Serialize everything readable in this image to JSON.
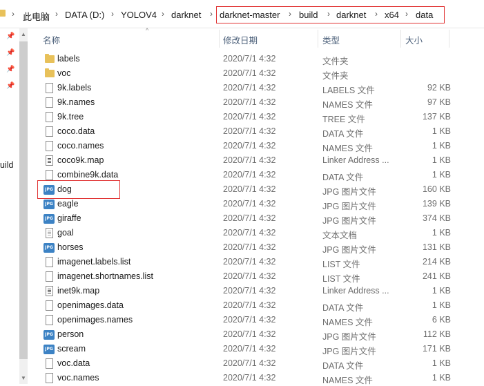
{
  "address_bar": {
    "crumbs": [
      "此电脑",
      "DATA (D:)",
      "YOLOV4",
      "darknet",
      "darknet-master",
      "build",
      "darknet",
      "x64",
      "data"
    ]
  },
  "nav_pane": {
    "partial_item": "uild"
  },
  "columns": {
    "name": "名称",
    "date": "修改日期",
    "type": "类型",
    "size": "大小"
  },
  "files": [
    {
      "name": "labels",
      "date": "2020/7/1 4:32",
      "type": "文件夹",
      "size": "",
      "icon": "folder-icon"
    },
    {
      "name": "voc",
      "date": "2020/7/1 4:32",
      "type": "文件夹",
      "size": "",
      "icon": "folder-icon"
    },
    {
      "name": "9k.labels",
      "date": "2020/7/1 4:32",
      "type": "LABELS 文件",
      "size": "92 KB",
      "icon": "file-icon"
    },
    {
      "name": "9k.names",
      "date": "2020/7/1 4:32",
      "type": "NAMES 文件",
      "size": "97 KB",
      "icon": "file-icon"
    },
    {
      "name": "9k.tree",
      "date": "2020/7/1 4:32",
      "type": "TREE 文件",
      "size": "137 KB",
      "icon": "file-icon"
    },
    {
      "name": "coco.data",
      "date": "2020/7/1 4:32",
      "type": "DATA 文件",
      "size": "1 KB",
      "icon": "file-icon"
    },
    {
      "name": "coco.names",
      "date": "2020/7/1 4:32",
      "type": "NAMES 文件",
      "size": "1 KB",
      "icon": "file-icon"
    },
    {
      "name": "coco9k.map",
      "date": "2020/7/1 4:32",
      "type": "Linker Address ...",
      "size": "1 KB",
      "icon": "map-file-icon"
    },
    {
      "name": "combine9k.data",
      "date": "2020/7/1 4:32",
      "type": "DATA 文件",
      "size": "1 KB",
      "icon": "file-icon"
    },
    {
      "name": "dog",
      "date": "2020/7/1 4:32",
      "type": "JPG 图片文件",
      "size": "160 KB",
      "icon": "jpg-icon"
    },
    {
      "name": "eagle",
      "date": "2020/7/1 4:32",
      "type": "JPG 图片文件",
      "size": "139 KB",
      "icon": "jpg-icon"
    },
    {
      "name": "giraffe",
      "date": "2020/7/1 4:32",
      "type": "JPG 图片文件",
      "size": "374 KB",
      "icon": "jpg-icon"
    },
    {
      "name": "goal",
      "date": "2020/7/1 4:32",
      "type": "文本文档",
      "size": "1 KB",
      "icon": "text-file-icon"
    },
    {
      "name": "horses",
      "date": "2020/7/1 4:32",
      "type": "JPG 图片文件",
      "size": "131 KB",
      "icon": "jpg-icon"
    },
    {
      "name": "imagenet.labels.list",
      "date": "2020/7/1 4:32",
      "type": "LIST 文件",
      "size": "214 KB",
      "icon": "file-icon"
    },
    {
      "name": "imagenet.shortnames.list",
      "date": "2020/7/1 4:32",
      "type": "LIST 文件",
      "size": "241 KB",
      "icon": "file-icon"
    },
    {
      "name": "inet9k.map",
      "date": "2020/7/1 4:32",
      "type": "Linker Address ...",
      "size": "1 KB",
      "icon": "map-file-icon"
    },
    {
      "name": "openimages.data",
      "date": "2020/7/1 4:32",
      "type": "DATA 文件",
      "size": "1 KB",
      "icon": "file-icon"
    },
    {
      "name": "openimages.names",
      "date": "2020/7/1 4:32",
      "type": "NAMES 文件",
      "size": "6 KB",
      "icon": "file-icon"
    },
    {
      "name": "person",
      "date": "2020/7/1 4:32",
      "type": "JPG 图片文件",
      "size": "112 KB",
      "icon": "jpg-icon"
    },
    {
      "name": "scream",
      "date": "2020/7/1 4:32",
      "type": "JPG 图片文件",
      "size": "171 KB",
      "icon": "jpg-icon"
    },
    {
      "name": "voc.data",
      "date": "2020/7/1 4:32",
      "type": "DATA 文件",
      "size": "1 KB",
      "icon": "file-icon"
    },
    {
      "name": "voc.names",
      "date": "2020/7/1 4:32",
      "type": "NAMES 文件",
      "size": "1 KB",
      "icon": "file-icon"
    }
  ],
  "jpg_icon_text": "JPG",
  "colors": {
    "highlight": "#e03030",
    "folder": "#e8c15a",
    "jpg_badge": "#3c82c4",
    "header_text": "#4c607a"
  }
}
